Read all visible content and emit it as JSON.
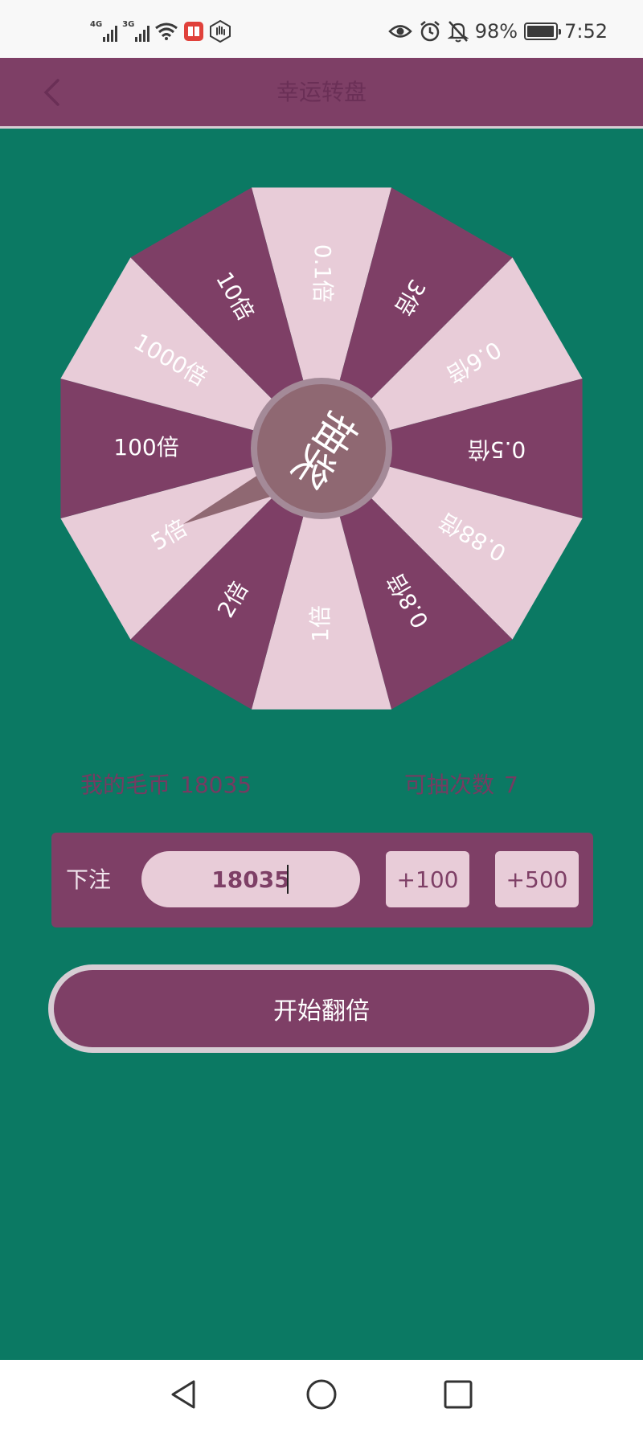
{
  "status_bar": {
    "network_1": "4G",
    "network_2": "3G",
    "battery_percent": "98%",
    "battery_level": 0.98,
    "time": "7:52",
    "icons": [
      "signal-icon",
      "signal-icon",
      "wifi-icon",
      "app-notification-icon",
      "hand-icon",
      "eye-icon",
      "alarm-icon",
      "mute-bell-icon",
      "battery-icon"
    ]
  },
  "header": {
    "title": "幸运转盘",
    "back_icon": "back-arrow-icon"
  },
  "wheel": {
    "center_label": "抽奖",
    "segments": [
      "0.1倍",
      "3倍",
      "0.6倍",
      "0.5倍",
      "0.88倍",
      "0.8倍",
      "1倍",
      "2倍",
      "5倍",
      "100倍",
      "1000倍",
      "10倍"
    ],
    "colors": {
      "dark": "#7e3f66",
      "light": "#e8ccd8",
      "hub": "#8f6872",
      "hub_ring": "#a48a98"
    }
  },
  "info": {
    "coins_label": "我的毛币",
    "coins_value": "18035",
    "draws_label": "可抽次数",
    "draws_value": "7"
  },
  "bet": {
    "label": "下注",
    "value": "18035",
    "add_100": "+100",
    "add_500": "+500"
  },
  "start_button": "开始翻倍",
  "nav": {
    "icons": [
      "nav-back-icon",
      "nav-home-icon",
      "nav-recents-icon"
    ]
  },
  "colors": {
    "background": "#0b7963",
    "primary": "#7e3f66",
    "accent_light": "#e8ccd8"
  }
}
